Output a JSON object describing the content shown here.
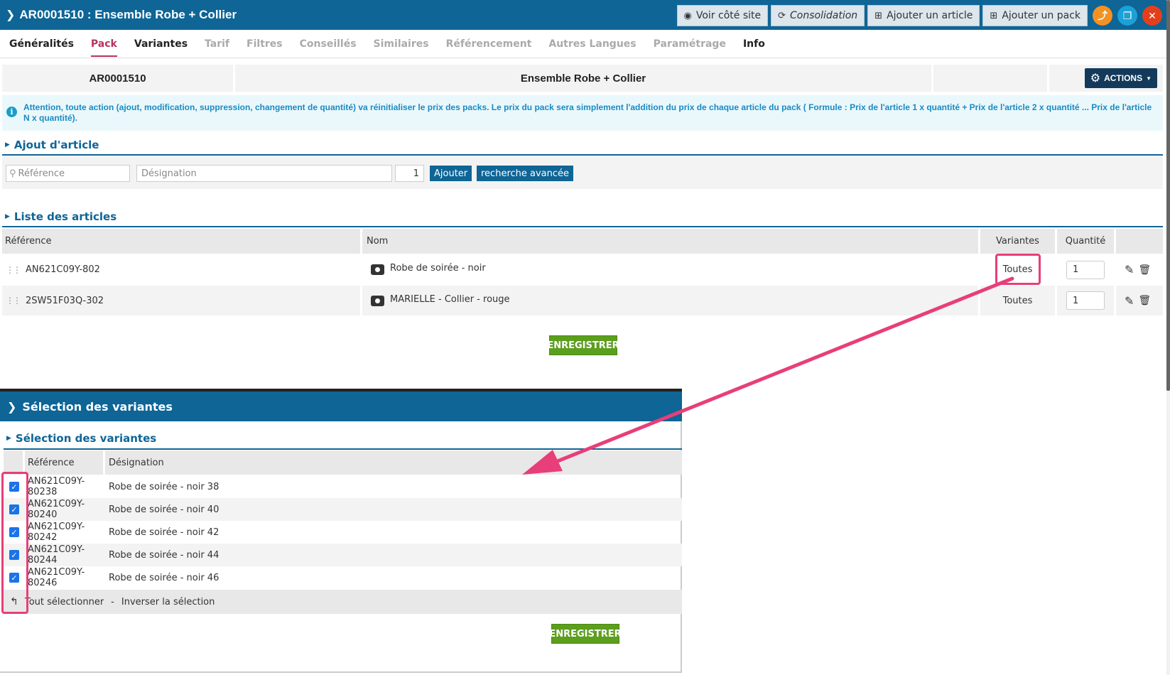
{
  "header": {
    "title": "AR0001510 : Ensemble Robe + Collier",
    "buttons": {
      "voir": "Voir côté site",
      "consolidation": "Consolidation",
      "ajouter_article": "Ajouter un article",
      "ajouter_pack": "Ajouter un pack"
    }
  },
  "tabs": [
    {
      "label": "Généralités"
    },
    {
      "label": "Pack"
    },
    {
      "label": "Variantes"
    },
    {
      "label": "Tarif"
    },
    {
      "label": "Filtres"
    },
    {
      "label": "Conseillés"
    },
    {
      "label": "Similaires"
    },
    {
      "label": "Référencement"
    },
    {
      "label": "Autres Langues"
    },
    {
      "label": "Paramétrage"
    },
    {
      "label": "Info"
    }
  ],
  "info": {
    "reference": "AR0001510",
    "name": "Ensemble Robe + Collier",
    "actions_label": "ACTIONS"
  },
  "warning": "Attention, toute action (ajout, modification, suppression, changement de quantité) va réinitialiser le prix des packs. Le prix du pack sera simplement l'addition du prix de chaque article du pack ( Formule : Prix de l'article 1 x quantité + Prix de l'article 2 x quantité ... Prix de l'article N x quantité).",
  "ajout": {
    "title": "Ajout d'article",
    "reference_placeholder": "Référence",
    "designation_placeholder": "Désignation",
    "qty": "1",
    "add_button": "Ajouter",
    "advanced_button": "recherche avancée"
  },
  "liste": {
    "title": "Liste des articles",
    "headers": {
      "reference": "Référence",
      "nom": "Nom",
      "variantes": "Variantes",
      "quantite": "Quantité"
    },
    "rows": [
      {
        "reference": "AN621C09Y-802",
        "nom": "Robe de soirée - noir",
        "variantes": "Toutes",
        "quantite": "1"
      },
      {
        "reference": "2SW51F03Q-302",
        "nom": "MARIELLE - Collier - rouge",
        "variantes": "Toutes",
        "quantite": "1"
      }
    ],
    "save_button": "ENREGISTRER"
  },
  "modal": {
    "title": "Sélection des variantes",
    "subtitle": "Sélection des variantes",
    "headers": {
      "reference": "Référence",
      "designation": "Désignation"
    },
    "rows": [
      {
        "reference": "AN621C09Y-80238",
        "designation": "Robe de soirée - noir 38"
      },
      {
        "reference": "AN621C09Y-80240",
        "designation": "Robe de soirée - noir 40"
      },
      {
        "reference": "AN621C09Y-80242",
        "designation": "Robe de soirée - noir 42"
      },
      {
        "reference": "AN621C09Y-80244",
        "designation": "Robe de soirée - noir 44"
      },
      {
        "reference": "AN621C09Y-80246",
        "designation": "Robe de soirée - noir 46"
      }
    ],
    "select_all": "Tout sélectionner",
    "separator": "-",
    "invert": "Inverser la sélection",
    "save_button": "ENREGISTRER"
  },
  "colors": {
    "primary": "#0e6596",
    "accent": "#b83262",
    "annotation": "#e83e7a",
    "save": "#5c9e1e"
  }
}
